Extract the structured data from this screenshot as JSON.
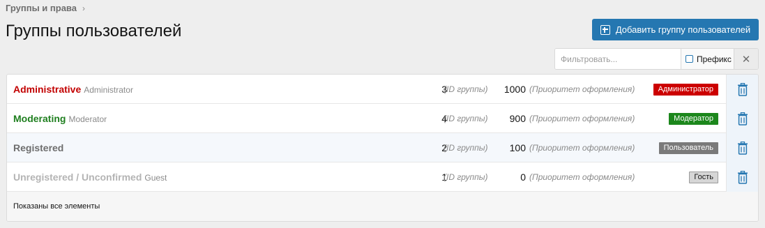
{
  "breadcrumb": {
    "label": "Группы и права"
  },
  "page": {
    "title": "Группы пользователей"
  },
  "toolbar": {
    "add_button_label": "Добавить группу пользователей"
  },
  "filter": {
    "placeholder": "Фильтровать...",
    "prefix_label": "Префикс",
    "clear_label": "✕"
  },
  "groups": [
    {
      "title": "Administrative",
      "subtitle": "Administrator",
      "id": "3",
      "id_label": "(ID группы)",
      "priority": "1000",
      "priority_label": "(Приоритет оформления)",
      "badge": "Администратор",
      "title_color": "#c20000",
      "badge_bg": "#cc0000",
      "badge_color": "#ffffff"
    },
    {
      "title": "Moderating",
      "subtitle": "Moderator",
      "id": "4",
      "id_label": "(ID группы)",
      "priority": "900",
      "priority_label": "(Приоритет оформления)",
      "badge": "Модератор",
      "title_color": "#1f7f1f",
      "badge_bg": "#1c871c",
      "badge_color": "#ffffff"
    },
    {
      "title": "Registered",
      "subtitle": "",
      "id": "2",
      "id_label": "(ID группы)",
      "priority": "100",
      "priority_label": "(Приоритет оформления)",
      "badge": "Пользователь",
      "title_color": "#6e6e6e",
      "badge_bg": "#7a7a7a",
      "badge_color": "#ffffff"
    },
    {
      "title": "Unregistered / Unconfirmed",
      "subtitle": "Guest",
      "id": "1",
      "id_label": "(ID группы)",
      "priority": "0",
      "priority_label": "(Приоритет оформления)",
      "badge": "Гость",
      "title_color": "#b4b4b4",
      "badge_bg": "#d6d6d6",
      "badge_color": "#141414"
    }
  ],
  "footer": {
    "text": "Показаны все элементы"
  },
  "icons": {
    "add": "plus-square-icon",
    "breadcrumb": "chevron-right-icon",
    "delete": "trash-icon",
    "checkbox": "checkbox-icon",
    "clear": "close-icon"
  },
  "colors": {
    "accent": "#2577b1",
    "page_bg": "#eeeeee"
  }
}
